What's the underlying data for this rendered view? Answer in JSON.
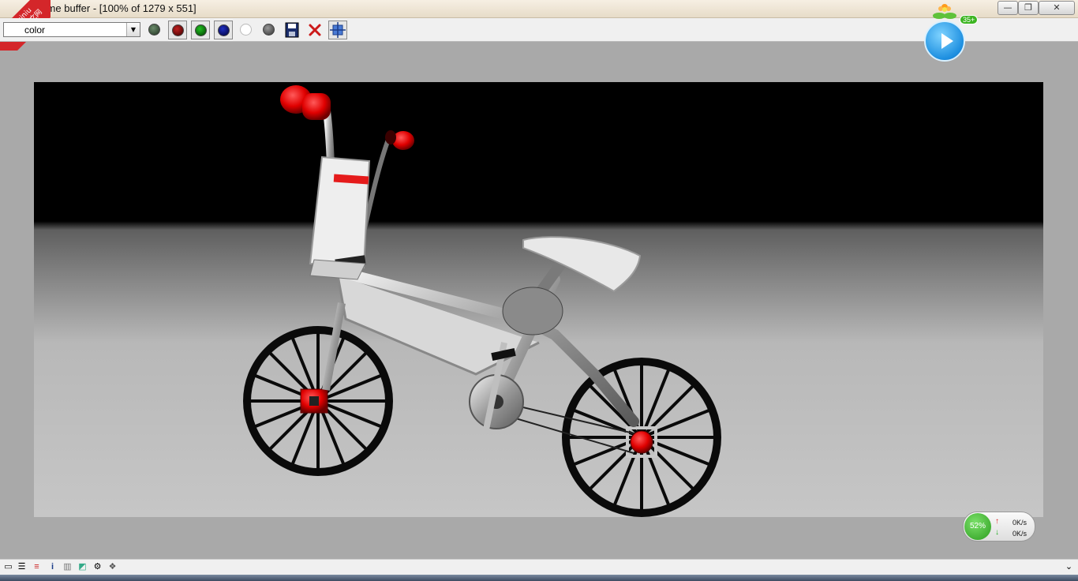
{
  "window": {
    "title": "rame buffer - [100% of 1279 x 551]",
    "minimize": "—",
    "restore": "❐",
    "close": "✕"
  },
  "toolbar": {
    "channel_select_value": "color",
    "buttons": [
      {
        "name": "rgb-channels-button",
        "color": "#3a5c3a"
      },
      {
        "name": "red-channel-button",
        "color": "#7a0000"
      },
      {
        "name": "green-channel-button",
        "color": "#0a7a0a"
      },
      {
        "name": "blue-channel-button",
        "color": "#00107a"
      },
      {
        "name": "alpha-channel-button",
        "color": "#ffffff"
      },
      {
        "name": "monochrome-button",
        "color": "#555555"
      }
    ]
  },
  "corner_logo": {
    "line1": "xuexiniu",
    "line2": "学犀牛中文网"
  },
  "float_widget": {
    "badge": "35+"
  },
  "net_widget": {
    "percent": "52%",
    "up": "0K/s",
    "down": "0K/s"
  }
}
